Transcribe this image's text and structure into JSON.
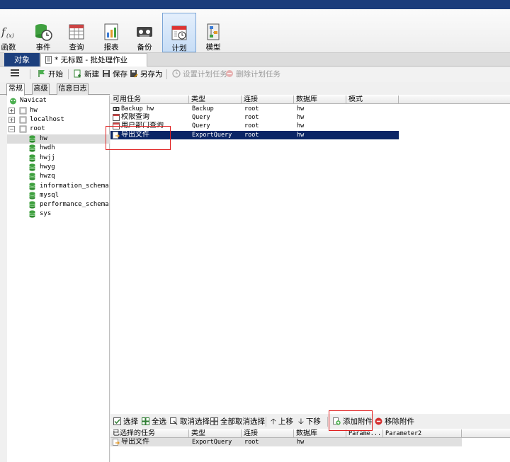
{
  "ribbon": {
    "items": [
      {
        "label": "函数",
        "icon": "function-icon"
      },
      {
        "label": "事件",
        "icon": "event-icon"
      },
      {
        "label": "查询",
        "icon": "query-icon"
      },
      {
        "label": "报表",
        "icon": "report-icon"
      },
      {
        "label": "备份",
        "icon": "backup-icon"
      },
      {
        "label": "计划",
        "icon": "schedule-icon",
        "active": true
      },
      {
        "label": "模型",
        "icon": "model-icon"
      }
    ]
  },
  "tabs": {
    "objects": "对象",
    "document": "* 无标题 - 批处理作业"
  },
  "toolbar": {
    "start": "开始",
    "new": "新建",
    "save": "保存",
    "save_as": "另存为",
    "set_schedule": "设置计划任务",
    "delete_schedule": "删除计划任务"
  },
  "subtabs": [
    "常规",
    "高级",
    "信息日志"
  ],
  "tree": {
    "root": "Navicat",
    "connections": [
      "hw",
      "localhost",
      "root"
    ],
    "databases": [
      "hw",
      "hwdh",
      "hwjj",
      "hwyg",
      "hwzq",
      "information_schema",
      "mysql",
      "performance_schema",
      "sys"
    ]
  },
  "available": {
    "columns": [
      "可用任务",
      "类型",
      "连接",
      "数据库",
      "模式"
    ],
    "rows": [
      {
        "task": "Backup hw",
        "type": "Backup",
        "connection": "root",
        "database": "hw"
      },
      {
        "task": "权限查询",
        "type": "Query",
        "connection": "root",
        "database": "hw"
      },
      {
        "task": "用户部门查询",
        "type": "Query",
        "connection": "root",
        "database": "hw"
      },
      {
        "task": "导出文件",
        "type": "ExportQuery",
        "connection": "root",
        "database": "hw"
      }
    ]
  },
  "bottombar": {
    "select": "选择",
    "select_all": "全选",
    "deselect": "取消选择",
    "deselect_all": "全部取消选择",
    "move_up": "上移",
    "move_down": "下移",
    "add_attachment": "添加附件",
    "remove_attachment": "移除附件"
  },
  "selected": {
    "columns": [
      "已选择的任务",
      "类型",
      "连接",
      "数据库",
      "Parame...",
      "Parameter2"
    ],
    "rows": [
      {
        "task": "导出文件",
        "type": "ExportQuery",
        "connection": "root",
        "database": "hw"
      }
    ]
  },
  "colors": {
    "titlebar": "#1a3c7b",
    "selection": "#0b2566",
    "highlight_box": "#e02020"
  }
}
